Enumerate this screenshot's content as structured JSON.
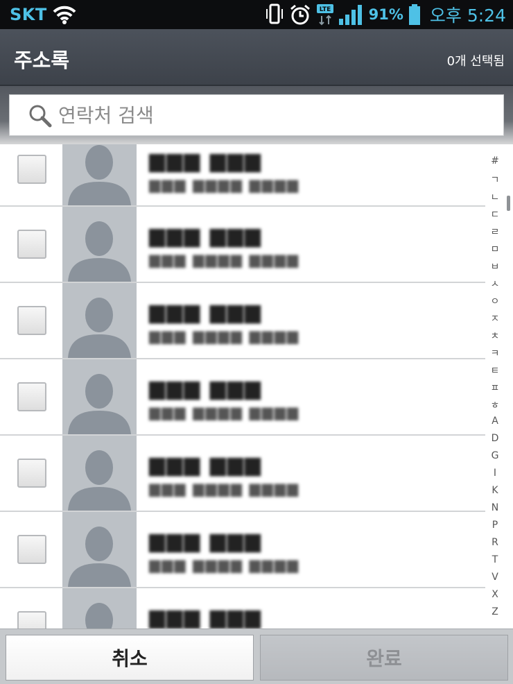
{
  "status_bar": {
    "carrier": "SKT",
    "network": "LTE",
    "battery": "91%",
    "time": "오후 5:24",
    "icons": [
      "wifi-icon",
      "vibrate-icon",
      "alarm-icon",
      "lte-icon",
      "signal-icon",
      "battery-icon"
    ],
    "accent_color": "#4ec1e6"
  },
  "header": {
    "title": "주소록",
    "selected_count": "0개 선택됨"
  },
  "search": {
    "placeholder": "연락처 검색",
    "icon": "search-icon"
  },
  "contacts": [
    {
      "name": "▆▆▆ ▆▆▆",
      "number": "▆▆▆ ▆▆▆▆ ▆▆▆▆",
      "checked": false
    },
    {
      "name": "▆▆▆ ▆▆▆",
      "number": "▆▆▆ ▆▆▆▆ ▆▆▆▆",
      "checked": false
    },
    {
      "name": "▆▆▆ ▆▆▆",
      "number": "▆▆▆ ▆▆▆▆ ▆▆▆▆",
      "checked": false
    },
    {
      "name": "▆▆▆ ▆▆▆",
      "number": "▆▆▆ ▆▆▆▆ ▆▆▆▆",
      "checked": false
    },
    {
      "name": "▆▆▆ ▆▆▆",
      "number": "▆▆▆ ▆▆▆▆ ▆▆▆▆",
      "checked": false
    },
    {
      "name": "▆▆▆ ▆▆▆",
      "number": "▆▆▆ ▆▆▆▆ ▆▆▆▆",
      "checked": false
    },
    {
      "name": "▆▆▆ ▆▆▆",
      "number": "",
      "checked": false
    }
  ],
  "index_letters": [
    "#",
    "ㄱ",
    "ㄴ",
    "ㄷ",
    "ㄹ",
    "ㅁ",
    "ㅂ",
    "ㅅ",
    "ㅇ",
    "ㅈ",
    "ㅊ",
    "ㅋ",
    "ㅌ",
    "ㅍ",
    "ㅎ",
    "A",
    "D",
    "G",
    "I",
    "K",
    "N",
    "P",
    "R",
    "T",
    "V",
    "X",
    "Z"
  ],
  "buttons": {
    "cancel": "취소",
    "done": "완료"
  }
}
